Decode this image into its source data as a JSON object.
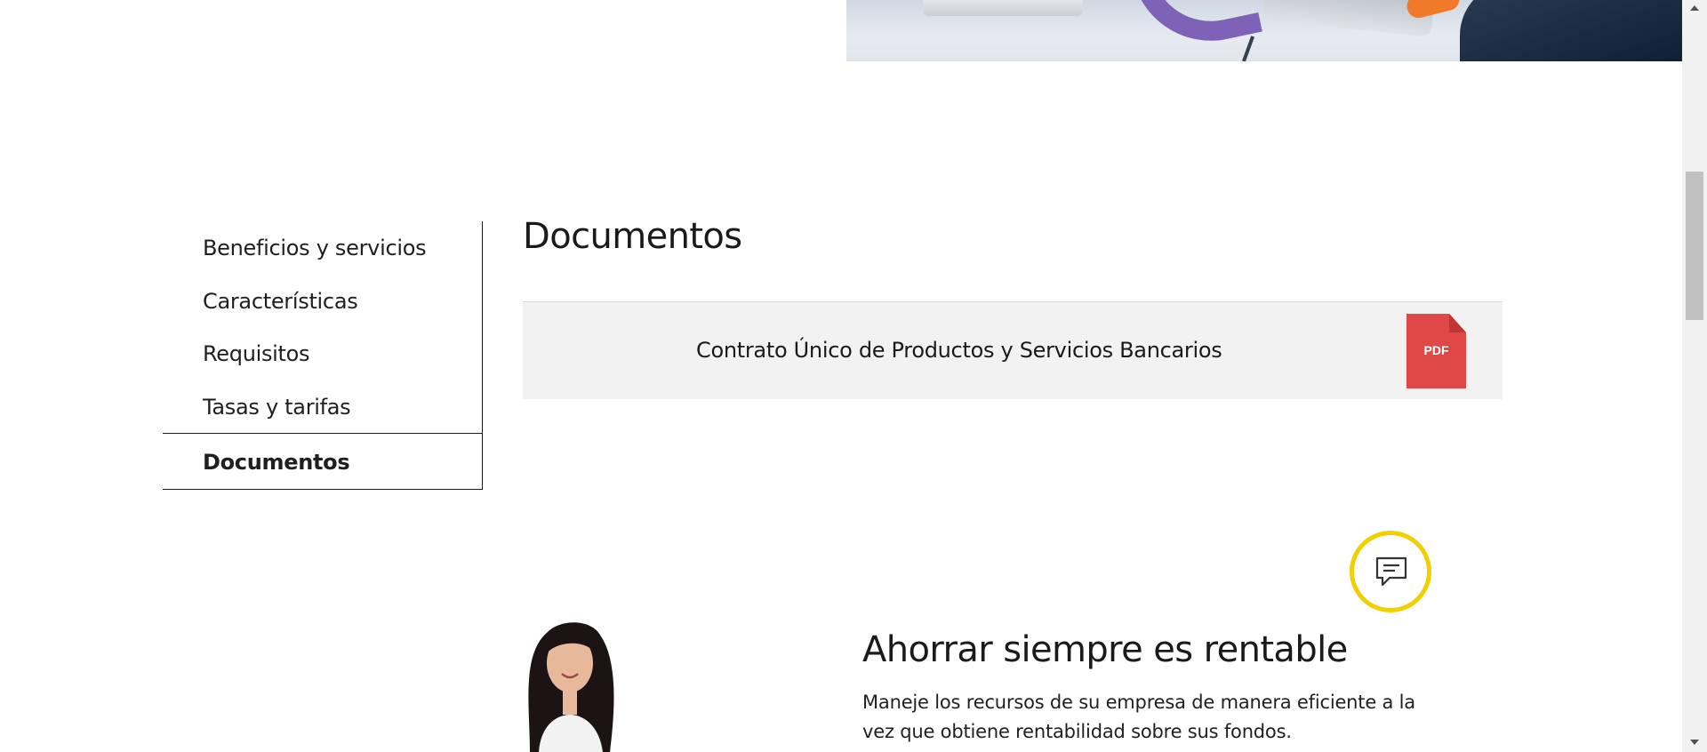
{
  "side_nav": {
    "items": [
      {
        "label": "Beneficios y servicios"
      },
      {
        "label": "Características"
      },
      {
        "label": "Requisitos"
      },
      {
        "label": "Tasas y tarifas"
      }
    ],
    "active_label": "Documentos"
  },
  "documents": {
    "title": "Documentos",
    "items": [
      {
        "name": "Contrato Único de Productos y Servicios Bancarios",
        "file_type": "PDF"
      }
    ]
  },
  "chat": {
    "icon": "chat-bubble-icon"
  },
  "promo": {
    "title": "Ahorrar siempre es rentable",
    "text": "Maneje los recursos de su empresa de manera eficiente a la vez que obtiene rentabilidad sobre sus fondos."
  },
  "colors": {
    "pdf_red": "#e04848",
    "chat_ring": "#f2cf00",
    "doc_row_bg": "#f2f2f2"
  }
}
